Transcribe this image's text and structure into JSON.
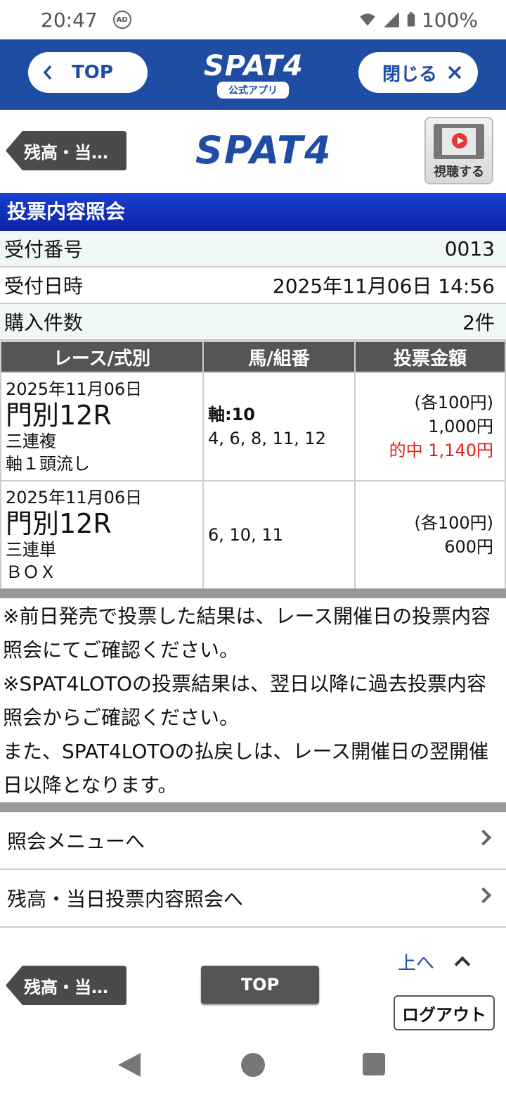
{
  "status_bar": {
    "time": "20:47",
    "ad_badge": "AD",
    "battery": "100%"
  },
  "app_bar": {
    "top_label": "TOP",
    "logo": "SPAT4",
    "logo_sub": "公式アプリ",
    "close_label": "閉じる"
  },
  "header": {
    "back_label": "残高・当…",
    "logo": "SPAT4",
    "watch_label": "視聴する"
  },
  "section_title": "投票内容照会",
  "info": {
    "receipt_no_label": "受付番号",
    "receipt_no": "0013",
    "datetime_label": "受付日時",
    "datetime": "2025年11月06日 14:56",
    "count_label": "購入件数",
    "count": "2件"
  },
  "table": {
    "headers": [
      "レース/式別",
      "馬/組番",
      "投票金額"
    ],
    "rows": [
      {
        "date": "2025年11月06日",
        "venue": "門別12R",
        "bet_type": "三連複",
        "method": "軸１頭流し",
        "axis": "軸:10",
        "numbers": "4, 6, 8, 11, 12",
        "unit": "(各100円)",
        "amount": "1,000円",
        "hit": "的中 1,140円"
      },
      {
        "date": "2025年11月06日",
        "venue": "門別12R",
        "bet_type": "三連単",
        "method": "ＢＯＸ",
        "axis": "",
        "numbers": "6, 10, 11",
        "unit": "(各100円)",
        "amount": "600円",
        "hit": ""
      }
    ]
  },
  "notes": [
    "※前日発売で投票した結果は、レース開催日の投票内容照会にてご確認ください。",
    "※SPAT4LOTOの投票結果は、翌日以降に過去投票内容照会からご確認ください。",
    "また、SPAT4LOTOの払戻しは、レース開催日の翌開催日以降となります。"
  ],
  "menu": {
    "inquiry_menu": "照会メニューへ",
    "balance_today": "残高・当日投票内容照会へ"
  },
  "footer": {
    "back_label": "残高・当…",
    "top_label": "TOP",
    "up_label": "上へ",
    "logout_label": "ログアウト"
  }
}
